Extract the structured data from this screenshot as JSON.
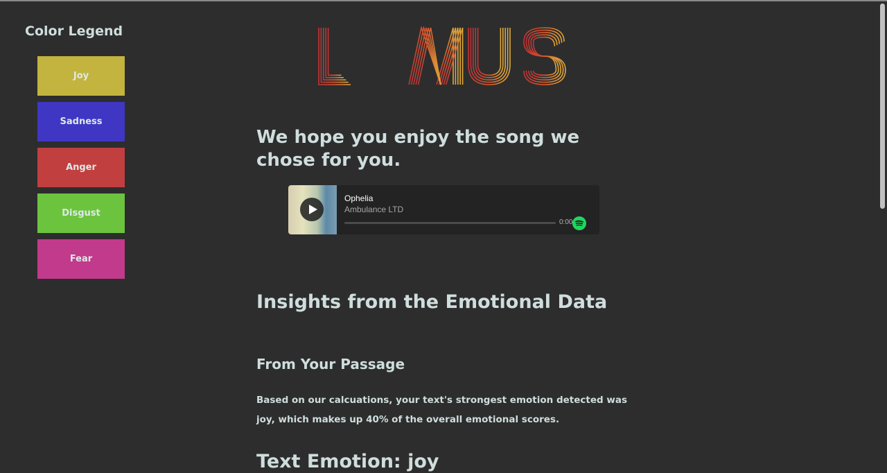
{
  "legend": {
    "title": "Color Legend",
    "items": [
      {
        "label": "Joy",
        "color": "#c2b43e"
      },
      {
        "label": "Sadness",
        "color": "#3f37c4"
      },
      {
        "label": "Anger",
        "color": "#c13f3f"
      },
      {
        "label": "Disgust",
        "color": "#6cc43e"
      },
      {
        "label": "Fear",
        "color": "#c23a8b"
      }
    ]
  },
  "logo": {
    "text": "LITMUS"
  },
  "song_heading": "We hope you enjoy the song we chose for you.",
  "player": {
    "title": "Ophelia",
    "artist": "Ambulance LTD",
    "time": "0:00",
    "play_icon": "play-icon",
    "brand_icon": "spotify-icon"
  },
  "insights_heading": "Insights from the Emotional Data",
  "passage_heading": "From Your Passage",
  "passage_text": "Based on our calcuations, your text's strongest emotion detected was joy, which makes up 40% of the overall emotional scores.",
  "text_emotion_heading": "Text Emotion: joy"
}
